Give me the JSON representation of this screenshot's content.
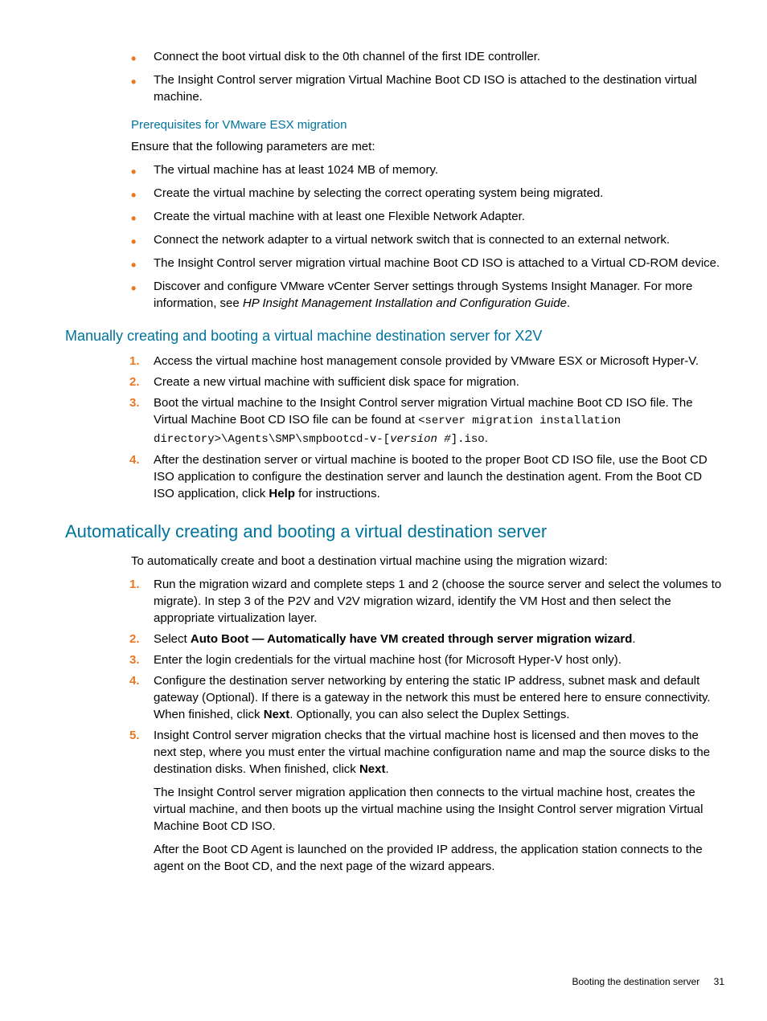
{
  "list_top": [
    "Connect the boot virtual disk to the 0th channel of the first IDE controller.",
    "The Insight Control server migration Virtual Machine Boot CD ISO is attached to the destination virtual machine."
  ],
  "heading_prereq": "Prerequisites for VMware ESX migration",
  "prereq_intro": "Ensure that the following parameters are met:",
  "list_prereq": {
    "item1": "The virtual machine has at least 1024 MB of memory.",
    "item2": "Create the virtual machine by selecting the correct operating system being migrated.",
    "item3": "Create the virtual machine with at least one Flexible Network Adapter.",
    "item4": "Connect the network adapter to a virtual network switch that is connected to an external network.",
    "item5": "The Insight Control server migration virtual machine Boot CD ISO is attached to a Virtual CD-ROM device.",
    "item6_a": "Discover and configure VMware vCenter Server settings through Systems Insight Manager. For more information, see ",
    "item6_b_italic": "HP Insight Management Installation and Configuration Guide",
    "item6_c": "."
  },
  "heading_manual": "Manually creating and booting a virtual machine destination server for X2V",
  "list_manual": {
    "item1": "Access the virtual machine host management console provided by VMware ESX or Microsoft Hyper-V.",
    "item2": "Create a new virtual machine with sufficient disk space for migration.",
    "item3_a": "Boot the virtual machine to the Insight Control server migration Virtual machine Boot CD ISO file. The Virtual Machine Boot CD ISO file can be found at ",
    "item3_b_mono": "<server migration installation directory>\\Agents\\SMP\\smpbootcd-v-[",
    "item3_c_monoitalic": "version #",
    "item3_d_mono": "].iso",
    "item3_e": ".",
    "item4_a": "After the destination server or virtual machine is booted to the proper Boot CD ISO file, use the Boot CD ISO application to configure the destination server and launch the destination agent. From the Boot CD ISO application, click ",
    "item4_b_bold": "Help",
    "item4_c": " for instructions."
  },
  "heading_auto": "Automatically creating and booting a virtual destination server",
  "auto_intro": "To automatically create and boot a destination virtual machine using the migration wizard:",
  "list_auto": {
    "item1": "Run the migration wizard and complete steps 1 and 2 (choose the source server and select the volumes to migrate). In step 3 of the P2V and V2V migration wizard, identify the VM Host and then select the appropriate virtualization layer.",
    "item2_a": "Select ",
    "item2_b_bold": "Auto Boot — Automatically have VM created through server migration wizard",
    "item2_c": ".",
    "item3": "Enter the login credentials for the virtual machine host (for Microsoft Hyper-V host only).",
    "item4_a": "Configure the destination server networking by entering the static IP address, subnet mask and default gateway (Optional). If there is a gateway in the network this must be entered here to ensure connectivity. When finished, click ",
    "item4_b_bold": "Next",
    "item4_c": ". Optionally, you can also select the Duplex Settings.",
    "item5_a": "Insight Control server migration checks that the virtual machine host is licensed and then moves to the next step, where you must enter the virtual machine configuration name and map the source disks to the destination disks. When finished, click ",
    "item5_b_bold": "Next",
    "item5_c": ".",
    "item5_p2": "The Insight Control server migration application then connects to the virtual machine host, creates the virtual machine, and then boots up the virtual machine using the Insight Control server migration Virtual Machine Boot CD ISO.",
    "item5_p3": "After the Boot CD Agent is launched on the provided IP address, the application station connects to the agent on the Boot CD, and the next page of the wizard appears."
  },
  "footer_text": "Booting the destination server",
  "footer_page": "31"
}
